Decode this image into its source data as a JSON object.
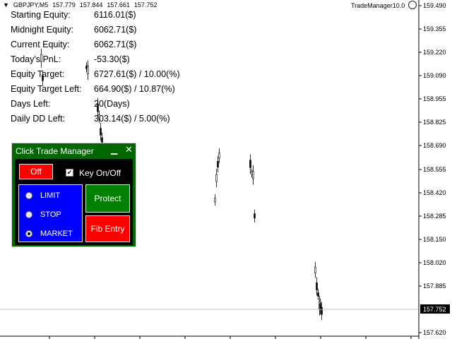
{
  "header": {
    "arrow": "▼",
    "symbol": "GBPJPY,M5",
    "ohlc": [
      "157.779",
      "157.844",
      "157.661",
      "157.752"
    ],
    "ea_name": "TradeManager10.0"
  },
  "stats": [
    {
      "label": "Starting Equity:",
      "value": "6116.01($)"
    },
    {
      "label": "Midnight Equity:",
      "value": "6062.71($)"
    },
    {
      "label": "Current Equity:",
      "value": "6062.71($)"
    },
    {
      "label": "Today's PnL:",
      "value": "-53.30($)"
    },
    {
      "label": "Equity Target:",
      "value": "6727.61($) / 10.00(%)"
    },
    {
      "label": "Equity Target Left:",
      "value": "664.90($) / 10.87(%)"
    },
    {
      "label": "Days Left:",
      "value": "20(Days)"
    },
    {
      "label": "Daily DD Left:",
      "value": "303.14($) / 5.00(%)"
    }
  ],
  "panel": {
    "title": "Click Trade Manager",
    "minimize_icon": "minimize-icon",
    "close_icon": "close-icon",
    "off_label": "Off",
    "key_toggle": {
      "label": "Key On/Off",
      "checked": true
    },
    "order_types": [
      {
        "label": "LIMIT",
        "selected": false
      },
      {
        "label": "STOP",
        "selected": false
      },
      {
        "label": "MARKET",
        "selected": true
      }
    ],
    "protect_label": "Protect",
    "fib_label": "Fib Entry",
    "colors": {
      "background": "#006600",
      "off": "#ff0000",
      "protect": "#008000",
      "fib": "#ff0000",
      "radio_box": "#0000ff"
    }
  },
  "price_axis": {
    "ticks": [
      "159.490",
      "159.355",
      "159.220",
      "159.090",
      "158.955",
      "158.825",
      "158.690",
      "158.555",
      "158.420",
      "158.285",
      "158.150",
      "158.020",
      "157.885",
      "157.752",
      "157.620"
    ],
    "current_price": "157.752"
  }
}
